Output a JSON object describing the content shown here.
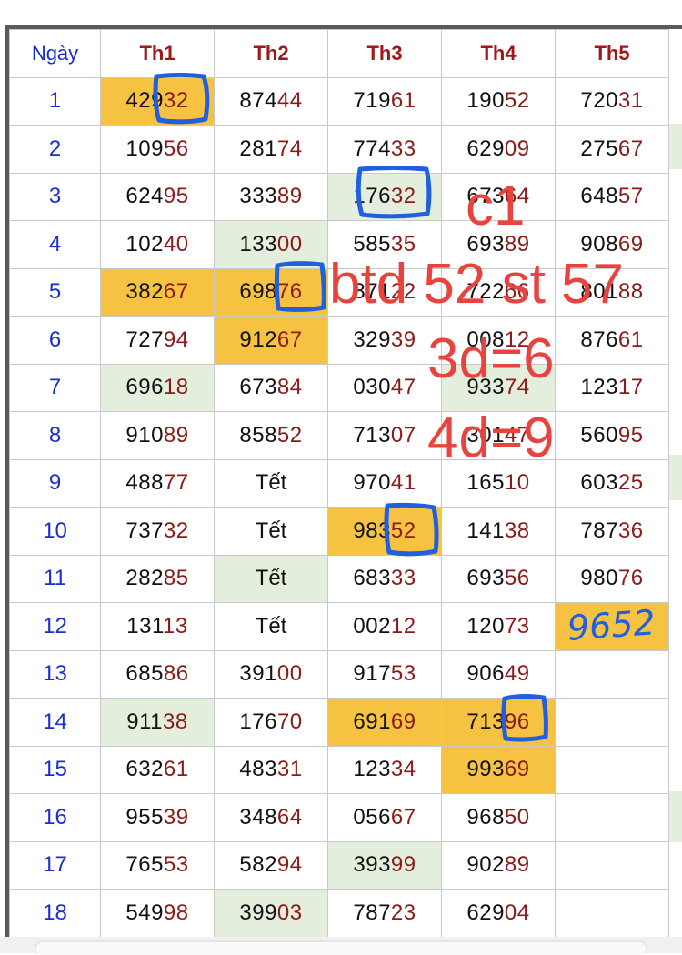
{
  "header": {
    "day_label": "Ngày",
    "columns": [
      "Th1",
      "Th2",
      "Th3",
      "Th4",
      "Th5"
    ]
  },
  "rows": [
    {
      "day": "1",
      "cells": [
        [
          "429",
          "32"
        ],
        [
          "874",
          "44"
        ],
        [
          "719",
          "61"
        ],
        [
          "190",
          "52"
        ],
        [
          "720",
          "31"
        ]
      ]
    },
    {
      "day": "2",
      "cells": [
        [
          "109",
          "56"
        ],
        [
          "281",
          "74"
        ],
        [
          "774",
          "33"
        ],
        [
          "629",
          "09"
        ],
        [
          "275",
          "67"
        ]
      ]
    },
    {
      "day": "3",
      "cells": [
        [
          "624",
          "95"
        ],
        [
          "333",
          "89"
        ],
        [
          "176",
          "32"
        ],
        [
          "673",
          "64"
        ],
        [
          "648",
          "57"
        ]
      ]
    },
    {
      "day": "4",
      "cells": [
        [
          "102",
          "40"
        ],
        [
          "133",
          "00"
        ],
        [
          "585",
          "35"
        ],
        [
          "693",
          "89"
        ],
        [
          "908",
          "69"
        ]
      ]
    },
    {
      "day": "5",
      "cells": [
        [
          "382",
          "67"
        ],
        [
          "698",
          "76"
        ],
        [
          "871",
          "22"
        ],
        [
          "722",
          "66"
        ],
        [
          "801",
          "88"
        ]
      ]
    },
    {
      "day": "6",
      "cells": [
        [
          "727",
          "94"
        ],
        [
          "912",
          "67"
        ],
        [
          "329",
          "39"
        ],
        [
          "008",
          "12"
        ],
        [
          "876",
          "61"
        ]
      ]
    },
    {
      "day": "7",
      "cells": [
        [
          "696",
          "18"
        ],
        [
          "673",
          "84"
        ],
        [
          "030",
          "47"
        ],
        [
          "933",
          "74"
        ],
        [
          "123",
          "17"
        ]
      ]
    },
    {
      "day": "8",
      "cells": [
        [
          "910",
          "89"
        ],
        [
          "858",
          "52"
        ],
        [
          "713",
          "07"
        ],
        [
          "301",
          "47"
        ],
        [
          "560",
          "95"
        ]
      ]
    },
    {
      "day": "9",
      "cells": [
        [
          "488",
          "77"
        ],
        "Tết",
        [
          "970",
          "41"
        ],
        [
          "165",
          "10"
        ],
        [
          "603",
          "25"
        ]
      ]
    },
    {
      "day": "10",
      "cells": [
        [
          "737",
          "32"
        ],
        "Tết",
        [
          "983",
          "52"
        ],
        [
          "141",
          "38"
        ],
        [
          "787",
          "36"
        ]
      ]
    },
    {
      "day": "11",
      "cells": [
        [
          "282",
          "85"
        ],
        "Tết",
        [
          "683",
          "33"
        ],
        [
          "693",
          "56"
        ],
        [
          "980",
          "76"
        ]
      ]
    },
    {
      "day": "12",
      "cells": [
        [
          "131",
          "13"
        ],
        "Tết",
        [
          "002",
          "12"
        ],
        [
          "120",
          "73"
        ],
        [
          "",
          ""
        ]
      ]
    },
    {
      "day": "13",
      "cells": [
        [
          "685",
          "86"
        ],
        [
          "391",
          "00"
        ],
        [
          "917",
          "53"
        ],
        [
          "906",
          "49"
        ],
        [
          "",
          ""
        ]
      ]
    },
    {
      "day": "14",
      "cells": [
        [
          "911",
          "38"
        ],
        [
          "176",
          "70"
        ],
        [
          "691",
          "69"
        ],
        [
          "713",
          "96"
        ],
        [
          "",
          ""
        ]
      ]
    },
    {
      "day": "15",
      "cells": [
        [
          "632",
          "61"
        ],
        [
          "483",
          "31"
        ],
        [
          "123",
          "34"
        ],
        [
          "993",
          "69"
        ],
        [
          "",
          ""
        ]
      ]
    },
    {
      "day": "16",
      "cells": [
        [
          "955",
          "39"
        ],
        [
          "348",
          "64"
        ],
        [
          "056",
          "67"
        ],
        [
          "968",
          "50"
        ],
        [
          "",
          ""
        ]
      ]
    },
    {
      "day": "17",
      "cells": [
        [
          "765",
          "53"
        ],
        [
          "582",
          "94"
        ],
        [
          "393",
          "99"
        ],
        [
          "902",
          "89"
        ],
        [
          "",
          ""
        ]
      ]
    },
    {
      "day": "18",
      "cells": [
        [
          "549",
          "98"
        ],
        [
          "399",
          "03"
        ],
        [
          "787",
          "23"
        ],
        [
          "629",
          "04"
        ],
        [
          "",
          ""
        ]
      ]
    }
  ],
  "highlights": {
    "orange": [
      "0-0",
      "4-0",
      "4-1",
      "5-1",
      "9-2",
      "11-4",
      "13-2",
      "13-3",
      "14-3"
    ],
    "green": [
      "2-2",
      "3-1",
      "6-0",
      "6-3",
      "10-1",
      "13-0",
      "16-2",
      "17-1"
    ]
  },
  "annotations": {
    "line1": "c1",
    "line2": "btd 52 st 57",
    "line3": "3d=6",
    "line4": "4d=9",
    "handwritten": "9652"
  },
  "colors": {
    "orange": "#f5c242",
    "green": "#e3efdc",
    "day_blue": "#1a2fcf",
    "header_red": "#a0191a",
    "suffix_red": "#8b1a1a",
    "ink_red": "#e8433f",
    "marker_blue": "#1f5fe0"
  }
}
